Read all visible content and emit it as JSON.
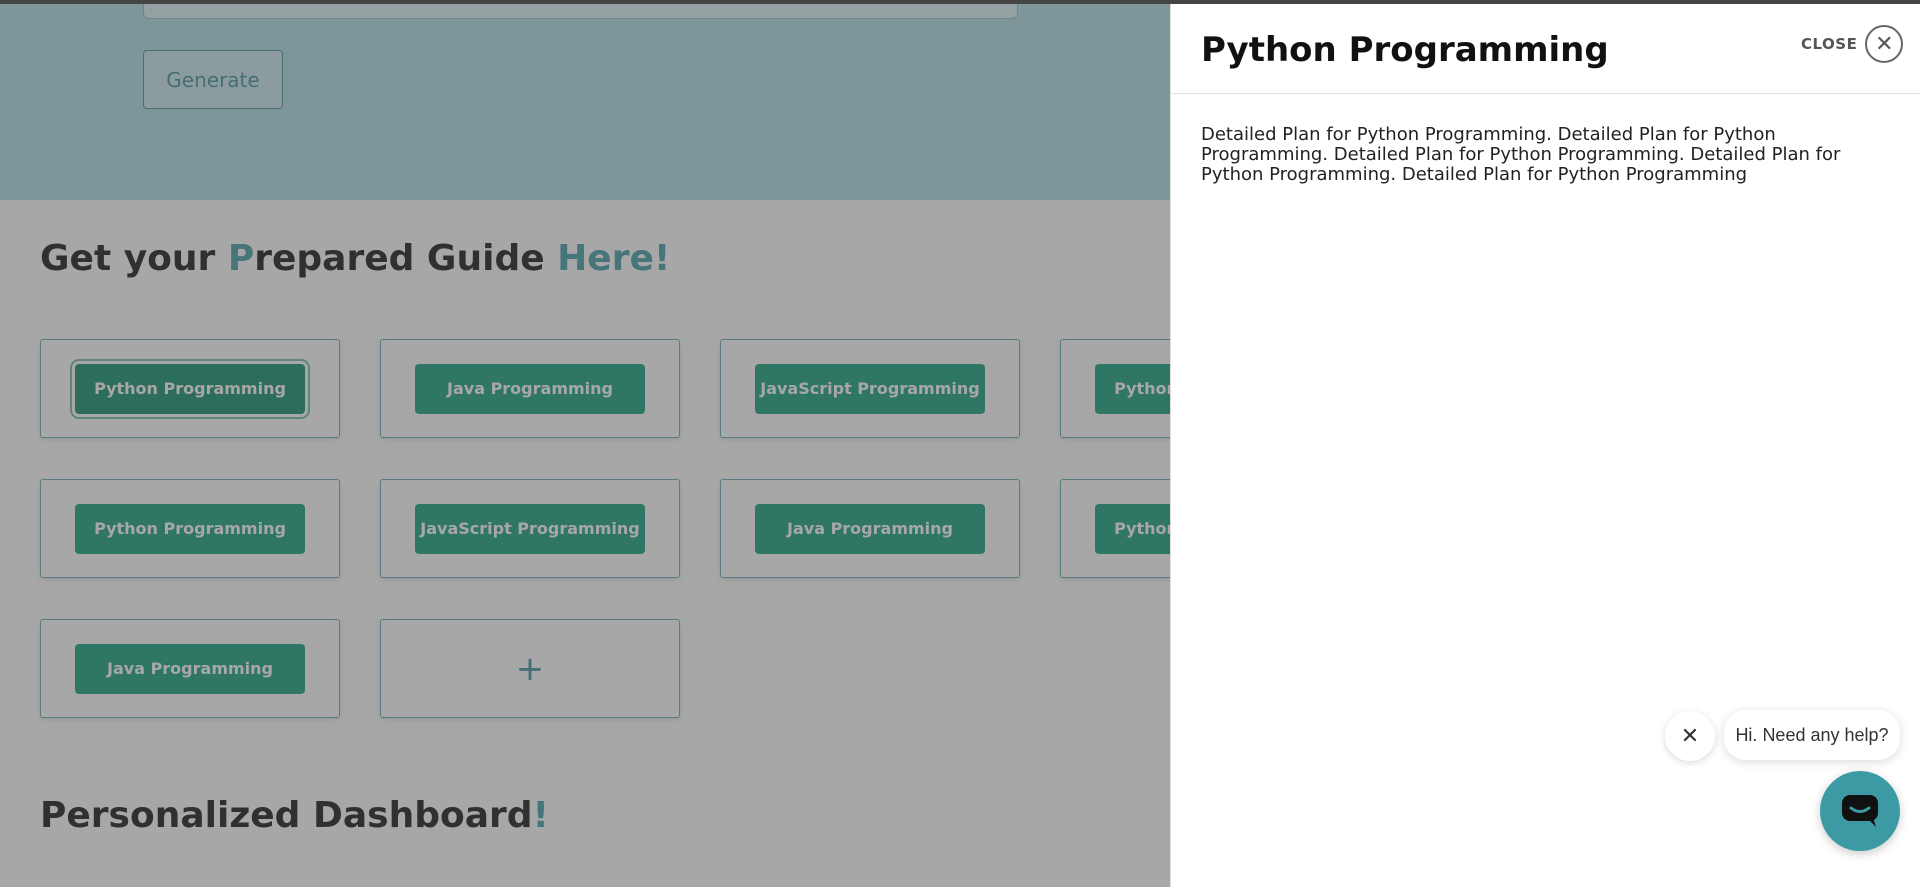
{
  "hero": {
    "generate_label": "Generate"
  },
  "guide_section": {
    "title_parts": [
      "Get your ",
      "P",
      "repared Guide ",
      "Here!"
    ]
  },
  "topic_cards": [
    {
      "label": "Python Programming"
    },
    {
      "label": "Java Programming"
    },
    {
      "label": "JavaScript Programming"
    },
    {
      "label": "Python Programming"
    },
    {
      "label": "Python Programming"
    },
    {
      "label": "JavaScript Programming"
    },
    {
      "label": "Java Programming"
    },
    {
      "label": "Python Programming"
    },
    {
      "label": "Java Programming"
    }
  ],
  "add_card": {
    "symbol": "+"
  },
  "dashboard_section": {
    "title": "Personalized Dashboard",
    "accent": "!"
  },
  "drawer": {
    "title": "Python Programming",
    "close_label": "CLOSE",
    "close_symbol": "✕",
    "body": "Detailed Plan for Python Programming. Detailed Plan for Python Programming. Detailed Plan for Python Programming. Detailed Plan for Python Programming. Detailed Plan for Python Programming"
  },
  "chat": {
    "greeting": "Hi. Need any help?",
    "dismiss_symbol": "✕"
  },
  "colors": {
    "accent": "#3c9aa5",
    "button_green": "#0f9d78",
    "hero_bg": "#a9dde4"
  },
  "icons": {
    "close": "close-icon",
    "chat": "chat-icon",
    "plus": "plus-icon"
  }
}
